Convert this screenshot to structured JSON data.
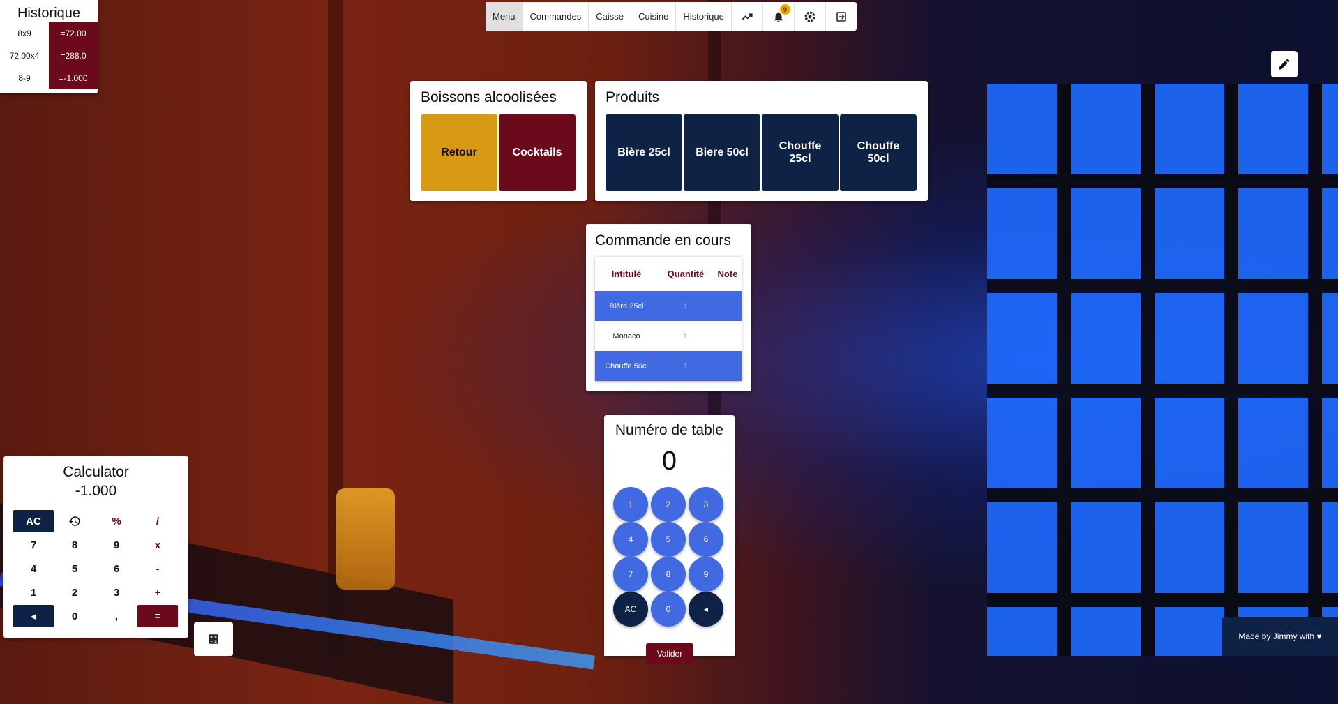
{
  "nav": {
    "items": [
      "Menu",
      "Commandes",
      "Caisse",
      "Cuisine",
      "Historique"
    ],
    "notification_count": "9"
  },
  "history": {
    "title": "Historique",
    "rows": [
      {
        "expr": "8x9",
        "result": "=72.00"
      },
      {
        "expr": "72.00x4",
        "result": "=288.0"
      },
      {
        "expr": "8-9",
        "result": "=-1.000"
      }
    ]
  },
  "boissons": {
    "title": "Boissons alcoolisées",
    "tiles": [
      "Retour",
      "Cocktails"
    ]
  },
  "produits": {
    "title": "Produits",
    "tiles": [
      "Bière 25cl",
      "Biere 50cl",
      "Chouffe 25cl",
      "Chouffe 50cl"
    ]
  },
  "commande": {
    "title": "Commande en cours",
    "headers": [
      "Intitulé",
      "Quantité",
      "Note"
    ],
    "rows": [
      {
        "name": "Bière 25cl",
        "qty": "1",
        "note": ""
      },
      {
        "name": "Monaco",
        "qty": "1",
        "note": ""
      },
      {
        "name": "Chouffe 50cl",
        "qty": "1",
        "note": ""
      }
    ]
  },
  "table_number": {
    "title": "Numéro de table",
    "value": "0",
    "keys": [
      "1",
      "2",
      "3",
      "4",
      "5",
      "6",
      "7",
      "8",
      "9",
      "AC",
      "0",
      "◂"
    ],
    "submit": "Valider"
  },
  "calculator": {
    "title": "Calculator",
    "display": "-1.000",
    "keys": [
      "AC",
      "⟲",
      "%",
      "/",
      "7",
      "8",
      "9",
      "x",
      "4",
      "5",
      "6",
      "-",
      "1",
      "2",
      "3",
      "+",
      "◂",
      "0",
      ",",
      "="
    ]
  },
  "footer": {
    "text": "Made by Jimmy with ♥"
  },
  "colors": {
    "wine": "#6b0a1a",
    "navy": "#0e2246",
    "gold": "#d89a12",
    "blue": "#4169e1"
  }
}
